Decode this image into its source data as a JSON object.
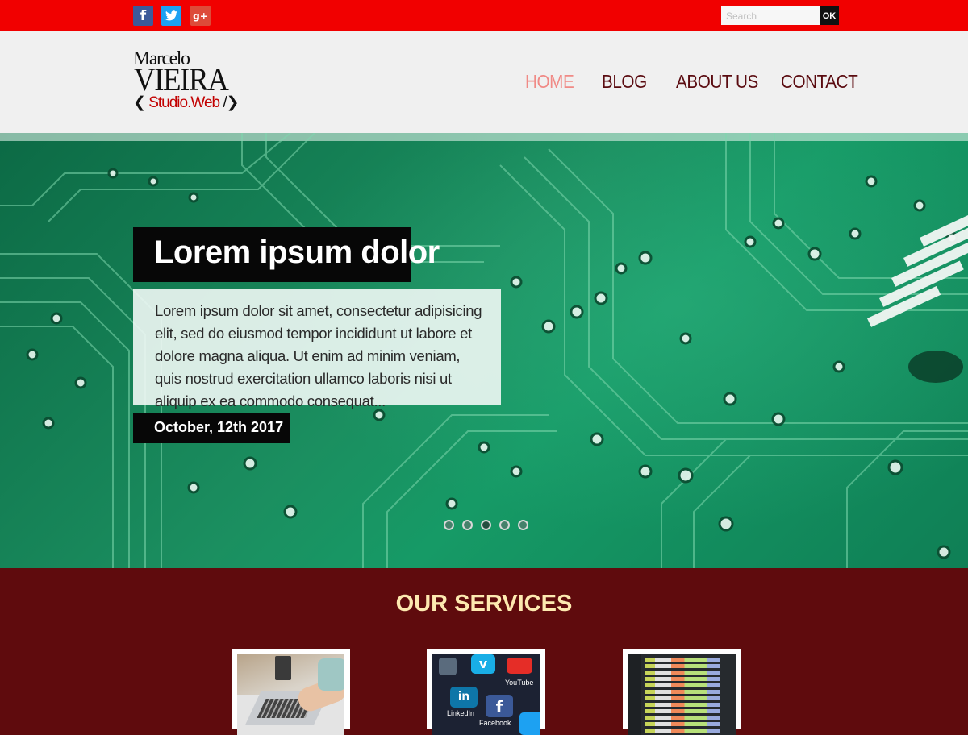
{
  "topbar": {
    "social": [
      {
        "name": "facebook",
        "glyph": "f",
        "color": "#3c5a9a"
      },
      {
        "name": "twitter",
        "glyph": "t",
        "color": "#1da1f2"
      },
      {
        "name": "google-plus",
        "glyph": "g+",
        "color": "#dd4b39"
      }
    ],
    "search": {
      "placeholder": "Search",
      "button_label": "OK"
    }
  },
  "logo": {
    "line1": "Marcelo",
    "line2": "VIEIRA",
    "line3_open": "❮ ",
    "line3_text": "Studio.Web",
    "line3_close": " /❯"
  },
  "nav": {
    "items": [
      "HOME",
      "BLOG",
      "ABOUT US",
      "CONTACT"
    ],
    "active": "HOME"
  },
  "hero": {
    "title": "Lorem ipsum dolor",
    "text": "Lorem ipsum dolor sit amet, consectetur adipisicing elit, sed do eiusmod tempor incididunt ut labore et dolore magna aliqua. Ut enim ad minim veniam, quis nostrud exercitation ullamco laboris nisi ut aliquip ex ea commodo consequat...",
    "date": "October, 12th 2017",
    "slide_count": 5,
    "active_slide": 3
  },
  "services": {
    "title": "OUR SERVICES",
    "cards": [
      {
        "name": "laptop-typing"
      },
      {
        "name": "social-apps",
        "app_labels": [
          "LinkedIn",
          "Facebook",
          "YouTube"
        ]
      },
      {
        "name": "code-editor"
      }
    ]
  },
  "colors": {
    "topbar": "#f10000",
    "header_bg": "#f0f0f0",
    "nav_text": "#5a0b10",
    "nav_active": "#f08a86",
    "services_bg": "#5f0b0d",
    "services_title": "#fde9b0"
  }
}
